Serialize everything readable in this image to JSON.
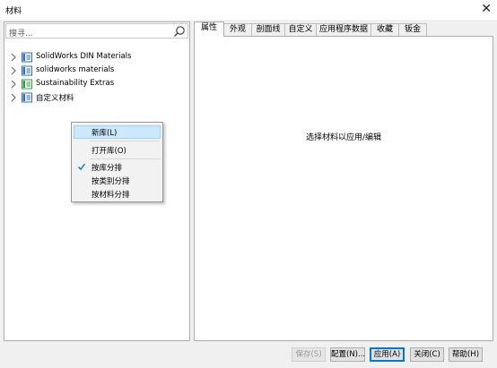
{
  "window": {
    "title": "材料",
    "close_glyph": "✕"
  },
  "search": {
    "placeholder": "搜寻..."
  },
  "tree": [
    {
      "label": "SolidWorks DIN Materials",
      "icon": "library-icon",
      "icon_color": "#2e6fb5"
    },
    {
      "label": "solidworks materials",
      "icon": "library-icon",
      "icon_color": "#2e6fb5"
    },
    {
      "label": "Sustainability Extras",
      "icon": "library-icon",
      "icon_color": "#2f9e3e"
    },
    {
      "label": "自定义材料",
      "icon": "library-icon",
      "icon_color": "#2e6fb5"
    }
  ],
  "tabs": [
    "属性",
    "外观",
    "剖面线",
    "自定义",
    "应用程序数据",
    "收藏",
    "钣金"
  ],
  "active_tab": "属性",
  "main": {
    "message": "选择材料以应用/编辑"
  },
  "context_menu": {
    "items": [
      {
        "label": "新库(L)",
        "highlighted": true
      },
      {
        "label": "打开库(O)"
      },
      {
        "label": "按库分排",
        "checked": true
      },
      {
        "label": "按类别分排"
      },
      {
        "label": "按材料分排"
      }
    ]
  },
  "buttons": {
    "save": "保存(S)",
    "config": "配置(N)...",
    "apply": "应用(A)",
    "close": "关闭(C)",
    "help": "帮助(H)"
  },
  "colors": {
    "highlight_bg": "#cce8ff",
    "highlight_border": "#99d1ff",
    "default_button_border": "#0078d7",
    "check": "#0078d7"
  }
}
